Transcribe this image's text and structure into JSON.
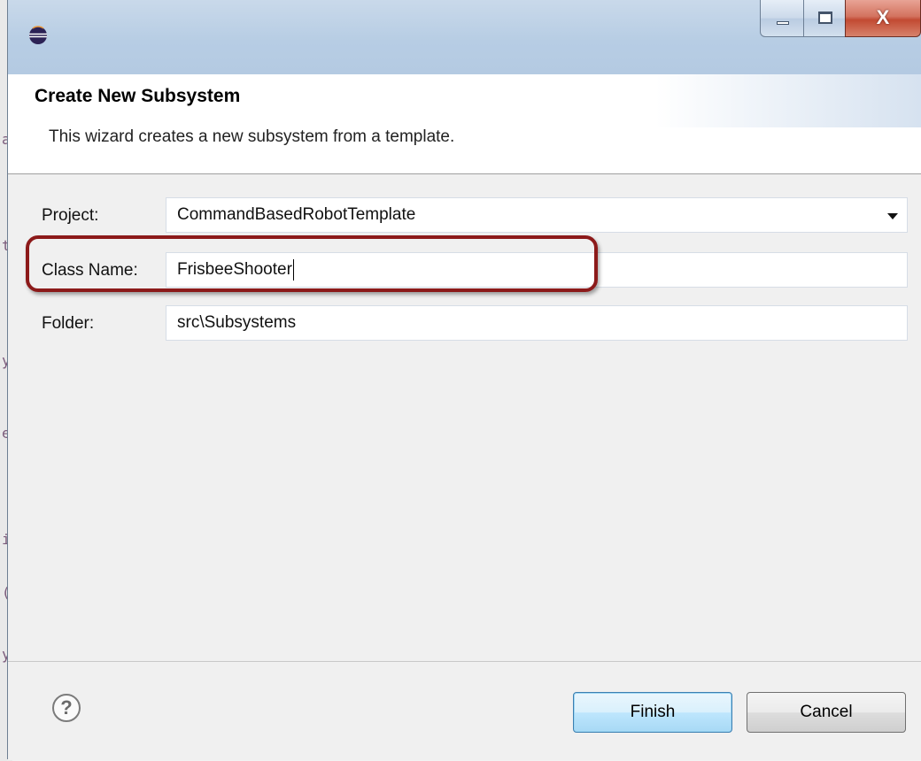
{
  "window": {
    "icon": "eclipse-icon",
    "controls": {
      "minimize": "minimize-icon",
      "maximize": "maximize-icon",
      "close": "X"
    }
  },
  "header": {
    "title": "Create New Subsystem",
    "description": "This wizard creates a new subsystem from a template."
  },
  "form": {
    "project": {
      "label": "Project:",
      "value": "CommandBasedRobotTemplate"
    },
    "class_name": {
      "label": "Class Name:",
      "value": "FrisbeeShooter"
    },
    "folder": {
      "label": "Folder:",
      "value": "src\\Subsystems"
    }
  },
  "footer": {
    "help_icon": "?",
    "finish_label": "Finish",
    "cancel_label": "Cancel"
  },
  "colors": {
    "highlight": "#8c1a1a",
    "titlebar": "#b7cde4",
    "close": "#c24a32"
  }
}
